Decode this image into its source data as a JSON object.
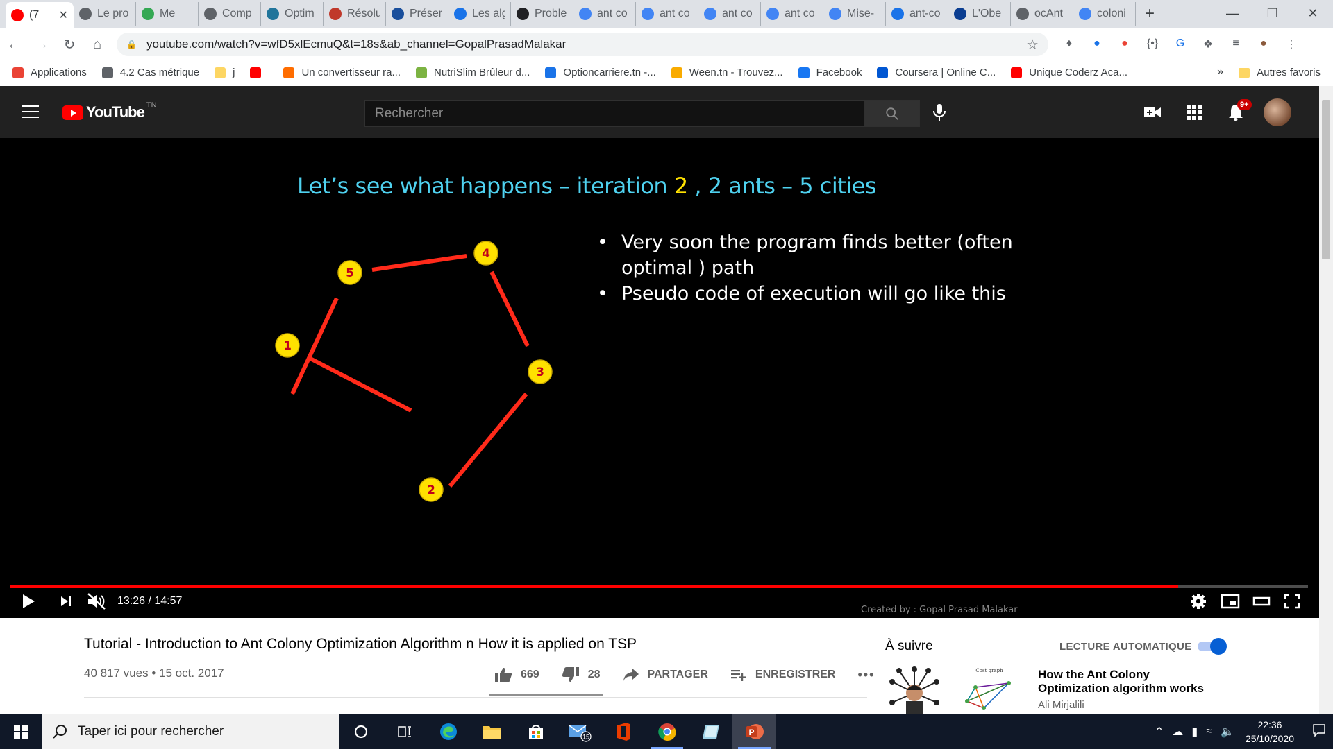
{
  "browser": {
    "tabs": [
      {
        "title": "(7",
        "color": "#ff0000",
        "active": true
      },
      {
        "title": "Le pro",
        "color": "#5f6368"
      },
      {
        "title": "Me",
        "color": "#34a853"
      },
      {
        "title": "Comp",
        "color": "#5f6368"
      },
      {
        "title": "Optim",
        "color": "#21759b"
      },
      {
        "title": "Résolu",
        "color": "#c0392b"
      },
      {
        "title": "Préser",
        "color": "#1a4f9c"
      },
      {
        "title": "Les alg",
        "color": "#1a73e8"
      },
      {
        "title": "Proble",
        "color": "#202124"
      },
      {
        "title": "ant co",
        "color": "#4285f4"
      },
      {
        "title": "ant co",
        "color": "#4285f4"
      },
      {
        "title": "ant co",
        "color": "#4285f4"
      },
      {
        "title": "ant co",
        "color": "#4285f4"
      },
      {
        "title": "Mise-",
        "color": "#4285f4"
      },
      {
        "title": "ant-co",
        "color": "#1a73e8"
      },
      {
        "title": "L'Obe",
        "color": "#0a3d91"
      },
      {
        "title": "ocAnt",
        "color": "#5f6368"
      },
      {
        "title": "coloni",
        "color": "#4285f4"
      }
    ],
    "url": "youtube.com/watch?v=wfD5xlEcmuQ&t=18s&ab_channel=GopalPrasadMalakar",
    "bookmarks": [
      {
        "label": "Applications",
        "color": "#ea4335"
      },
      {
        "label": "4.2 Cas métrique",
        "color": "#5f6368"
      },
      {
        "label": "j",
        "color": "#fdd663"
      },
      {
        "label": "",
        "color": "#ff0000"
      },
      {
        "label": "Un convertisseur ra...",
        "color": "#ff6d00"
      },
      {
        "label": "NutriSlim Brûleur d...",
        "color": "#7cb342"
      },
      {
        "label": "Optioncarriere.tn -...",
        "color": "#1a73e8"
      },
      {
        "label": "Ween.tn - Trouvez...",
        "color": "#f9ab00"
      },
      {
        "label": "Facebook",
        "color": "#1877f2"
      },
      {
        "label": "Coursera | Online C...",
        "color": "#0056d2"
      },
      {
        "label": "Unique Coderz Aca...",
        "color": "#ff0000"
      }
    ],
    "bookmarks_more": "»",
    "other_bookmarks": "Autres favoris"
  },
  "youtube": {
    "logo_text": "YouTube",
    "country": "TN",
    "search_placeholder": "Rechercher",
    "notif_count": "9+",
    "slide": {
      "title_pre": "Let’s see what happens – iteration ",
      "title_iter": "2",
      "title_post": " , 2 ants – 5 cities",
      "bullets": [
        "Very soon the program finds better (often optimal ) path",
        "Pseudo code of execution will go like this"
      ],
      "nodes": [
        "1",
        "2",
        "3",
        "4",
        "5"
      ],
      "credit": "Created by : Gopal Prasad Malakar"
    },
    "player": {
      "time": "13:26 / 14:57",
      "progress": 0.9
    },
    "video": {
      "title": "Tutorial - Introduction to Ant Colony Optimization Algorithm n How it is applied on TSP",
      "meta": "40 817 vues • 15 oct. 2017",
      "likes": "669",
      "dislikes": "28",
      "share": "PARTAGER",
      "save": "ENREGISTRER",
      "more": "•••"
    },
    "sidebar": {
      "up_next": "À suivre",
      "autoplay": "LECTURE AUTOMATIQUE",
      "rec_title": "How the Ant Colony Optimization algorithm works",
      "rec_channel": "Ali Mirjalili",
      "rec_thumb_label": "Cost graph"
    }
  },
  "taskbar": {
    "search_placeholder": "Taper ici pour rechercher",
    "mail_badge": "15",
    "time": "22:36",
    "date": "25/10/2020"
  }
}
